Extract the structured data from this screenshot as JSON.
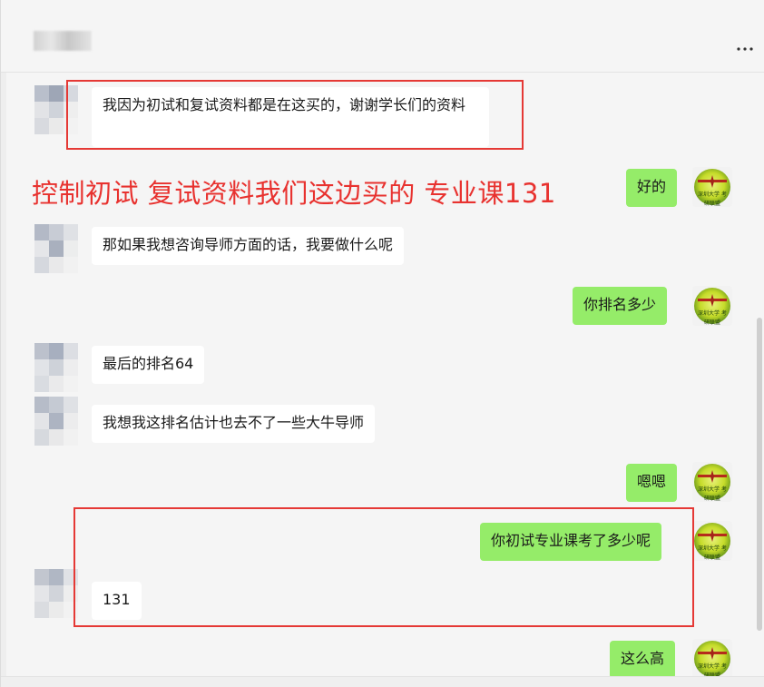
{
  "header": {
    "title": "",
    "more_icon": "more-horizontal-icon",
    "more_label": "..."
  },
  "annotation": "控制初试 复试资料我们这边买的 专业课131",
  "colors": {
    "outgoing_bubble": "#95ec69",
    "incoming_bubble": "#ffffff",
    "annotation_red": "#e8322f",
    "highlight_box": "#e53935"
  },
  "messages": [
    {
      "side": "in",
      "text": "我因为初试和复试资料都是在这买的，谢谢学长们的资料"
    },
    {
      "side": "out",
      "text": "好的"
    },
    {
      "side": "in",
      "text": "那如果我想咨询导师方面的话，我要做什么呢"
    },
    {
      "side": "out",
      "text": "你排名多少"
    },
    {
      "side": "in",
      "text": "最后的排名64"
    },
    {
      "side": "in",
      "text": "我想我这排名估计也去不了一些大牛导师"
    },
    {
      "side": "out",
      "text": "嗯嗯"
    },
    {
      "side": "out",
      "text": "你初试专业课考了多少呢"
    },
    {
      "side": "in",
      "text": "131"
    },
    {
      "side": "out",
      "text": "这么高"
    }
  ],
  "logo_text": "深圳大学 考研联盟"
}
